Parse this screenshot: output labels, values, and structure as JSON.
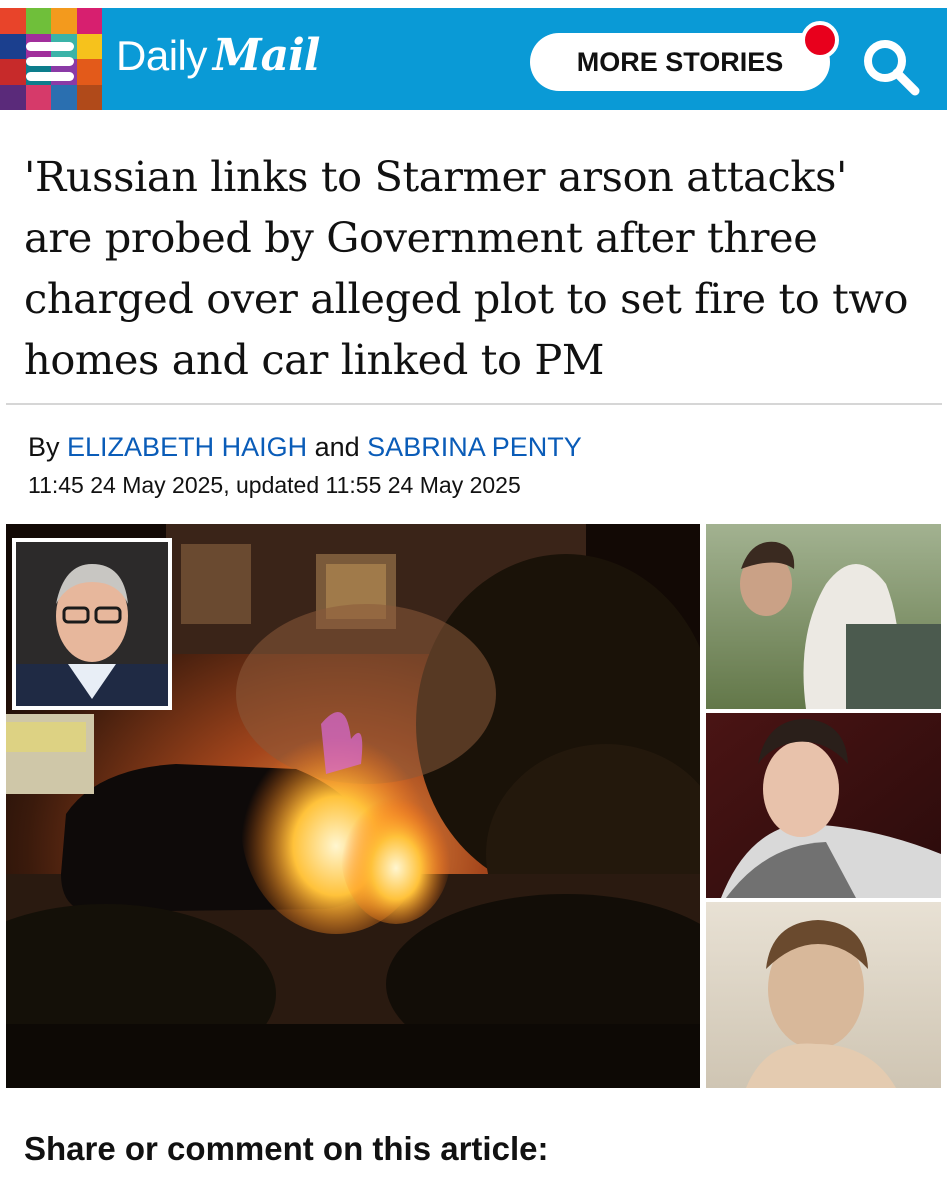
{
  "header": {
    "logo_daily": "Daily",
    "logo_mail": "Mail",
    "more_stories_label": "MORE STORIES",
    "background_color": "#0a9ad6",
    "notification_color": "#e8001c",
    "mosaic_colors": [
      "#e8442a",
      "#6fbf3a",
      "#f39a1d",
      "#d71f6f",
      "#1b3f8e",
      "#a12f9b",
      "#3bb3a8",
      "#f6c21c",
      "#c72a2a",
      "#0d7d8c",
      "#8a3aa6",
      "#e35a1a",
      "#5a2a7a",
      "#d63a6a",
      "#2a6fb0",
      "#b04a1a"
    ],
    "icons": [
      "menu-icon",
      "search-icon"
    ]
  },
  "article": {
    "headline": "'Russian links to Starmer arson attacks' are probed by Government after three charged over alleged plot to set fire to two homes and car linked to PM",
    "byline_prefix": "By",
    "author_1": "ELIZABETH HAIGH",
    "byline_and": "and",
    "author_2": "SABRINA PENTY",
    "author_link_color": "#0a5cb8",
    "timestamp": "11:45 24 May 2025, updated 11:55 24 May 2025"
  },
  "footer": {
    "share_label": "Share or comment on this article:"
  }
}
